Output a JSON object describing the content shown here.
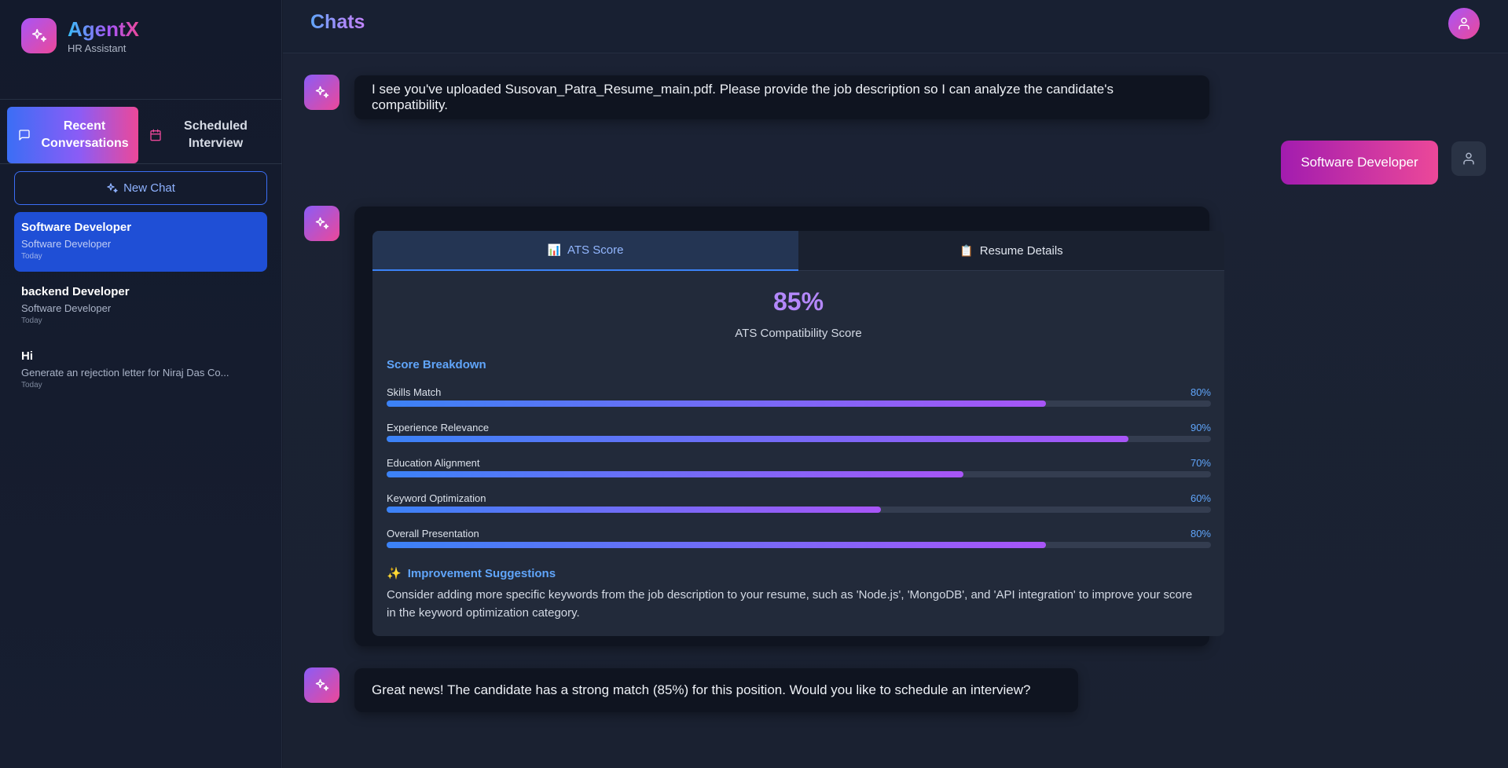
{
  "brand": {
    "name": "AgentX",
    "subtitle": "HR Assistant"
  },
  "sidebar": {
    "tabs": [
      {
        "label": "Recent Conversations",
        "icon": "chat-bubble-icon",
        "active": true
      },
      {
        "label": "Scheduled Interview",
        "icon": "calendar-icon",
        "active": false
      }
    ],
    "new_chat_label": "New Chat",
    "conversations": [
      {
        "title": "Software Developer",
        "subtitle": "Software Developer",
        "time": "Today",
        "active": true
      },
      {
        "title": "backend Developer",
        "subtitle": "Software Developer",
        "time": "Today",
        "active": false
      },
      {
        "title": "Hi",
        "subtitle": "Generate an rejection letter for Niraj Das Co...",
        "time": "Today",
        "active": false
      }
    ]
  },
  "header": {
    "title": "Chats",
    "avatar_icon": "user-icon"
  },
  "chat": {
    "messages": [
      {
        "role": "bot",
        "text": "I see you've uploaded Susovan_Patra_Resume_main.pdf. Please provide the job description so I can analyze the candidate's compatibility."
      },
      {
        "role": "user",
        "text": "Software Developer"
      },
      {
        "role": "bot",
        "type": "ats_card"
      },
      {
        "role": "bot",
        "text": "Great news! The candidate has a strong match (85%) for this position. Would you like to schedule an interview?"
      }
    ],
    "ats_card": {
      "tabs": [
        {
          "emoji": "📊",
          "label": "ATS Score",
          "active": true
        },
        {
          "emoji": "📋",
          "label": "Resume Details",
          "active": false
        }
      ],
      "score": "85%",
      "score_label": "ATS Compatibility Score",
      "breakdown_title": "Score Breakdown",
      "metrics": [
        {
          "name": "Skills Match",
          "value": "80%",
          "percent": 80
        },
        {
          "name": "Experience Relevance",
          "value": "90%",
          "percent": 90
        },
        {
          "name": "Education Alignment",
          "value": "70%",
          "percent": 70
        },
        {
          "name": "Keyword Optimization",
          "value": "60%",
          "percent": 60
        },
        {
          "name": "Overall Presentation",
          "value": "80%",
          "percent": 80
        }
      ],
      "improvement_emoji": "✨",
      "improvement_title": "Improvement Suggestions",
      "improvement_text": "Consider adding more specific keywords from the job description to your resume, such as 'Node.js', 'MongoDB', and 'API integration' to improve your score in the keyword optimization category."
    }
  },
  "colors": {
    "accent_blue": "#3b82f6",
    "accent_purple": "#a855f7",
    "accent_pink": "#ec4899",
    "bg": "#151b2b"
  }
}
